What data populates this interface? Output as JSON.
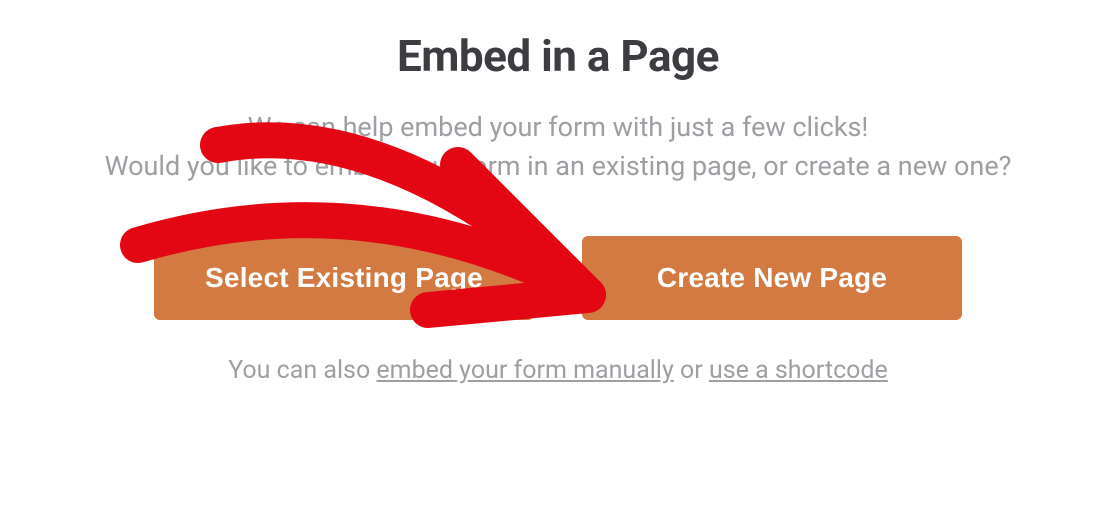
{
  "modal": {
    "title": "Embed in a Page",
    "description_line1": "We can help embed your form with just a few clicks!",
    "description_line2": "Would you like to embed your form in an existing page, or create a new one?"
  },
  "buttons": {
    "select_existing": "Select Existing Page",
    "create_new": "Create New Page"
  },
  "footer": {
    "prefix": "You can also ",
    "link1": "embed your form manually",
    "or": " or ",
    "link2": "use a shortcode"
  },
  "annotation": {
    "color": "#e30613"
  }
}
